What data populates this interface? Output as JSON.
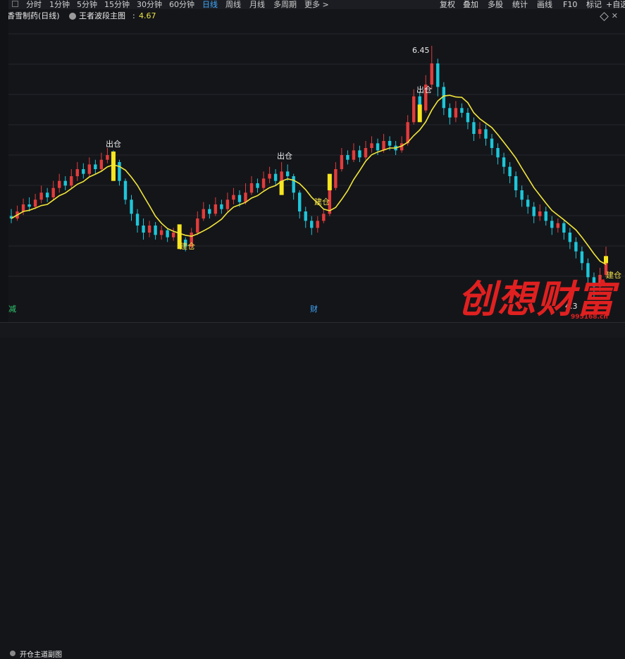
{
  "toolbar": {
    "periods": [
      "分时",
      "1分钟",
      "5分钟",
      "15分钟",
      "30分钟",
      "60分钟",
      "日线",
      "周线",
      "月线",
      "多周期",
      "更多 >"
    ],
    "active_period": "日线",
    "right_tools": [
      "复权",
      "叠加",
      "多股",
      "统计",
      "画线",
      "F10",
      "标记",
      "+自选"
    ]
  },
  "info": {
    "stock_name": "香雪制药(日线)",
    "indicator_name": "王者波段主图",
    "colon": ":",
    "indicator_value": "4.67"
  },
  "signals": {
    "sell_label": "出仓",
    "buy_label": "建仓"
  },
  "peak_price": "6.45",
  "bottom_price": "4.3",
  "bottom_tags": {
    "left": "减",
    "right": "财"
  },
  "sub_indicator": "开仓主道副图",
  "watermark": {
    "text": "创想财富",
    "url": "995168.cn"
  },
  "colors": {
    "up": "#e23c3c",
    "down": "#1ec6d9",
    "ma": "#f2e63a",
    "signal": "#f7e51f"
  },
  "chart_data": {
    "type": "candlestick",
    "note_series": "daily prices",
    "candles": [
      [
        5.0,
        4.98,
        5.06,
        4.94
      ],
      [
        4.98,
        5.04,
        5.09,
        4.96
      ],
      [
        5.04,
        5.1,
        5.15,
        5.01
      ],
      [
        5.1,
        5.08,
        5.16,
        5.04
      ],
      [
        5.08,
        5.14,
        5.19,
        5.06
      ],
      [
        5.14,
        5.2,
        5.26,
        5.11
      ],
      [
        5.2,
        5.16,
        5.24,
        5.12
      ],
      [
        5.16,
        5.24,
        5.3,
        5.14
      ],
      [
        5.24,
        5.3,
        5.36,
        5.2
      ],
      [
        5.3,
        5.26,
        5.34,
        5.22
      ],
      [
        5.26,
        5.34,
        5.4,
        5.24
      ],
      [
        5.34,
        5.4,
        5.46,
        5.3
      ],
      [
        5.4,
        5.36,
        5.45,
        5.32
      ],
      [
        5.36,
        5.44,
        5.5,
        5.33
      ],
      [
        5.44,
        5.4,
        5.48,
        5.36
      ],
      [
        5.4,
        5.48,
        5.54,
        5.38
      ],
      [
        5.48,
        5.52,
        5.58,
        5.45
      ],
      [
        5.52,
        5.46,
        5.56,
        5.42
      ],
      [
        5.46,
        5.3,
        5.48,
        5.26
      ],
      [
        5.3,
        5.14,
        5.32,
        5.1
      ],
      [
        5.14,
        5.02,
        5.18,
        4.96
      ],
      [
        5.02,
        4.92,
        5.06,
        4.86
      ],
      [
        4.92,
        4.86,
        4.98,
        4.8
      ],
      [
        4.86,
        4.92,
        4.96,
        4.82
      ],
      [
        4.92,
        4.84,
        4.95,
        4.8
      ],
      [
        4.84,
        4.88,
        4.92,
        4.8
      ],
      [
        4.88,
        4.82,
        4.9,
        4.78
      ],
      [
        4.82,
        4.86,
        4.9,
        4.79
      ],
      [
        4.86,
        4.8,
        4.88,
        4.76
      ],
      [
        4.8,
        4.74,
        4.82,
        4.7
      ],
      [
        4.74,
        4.86,
        4.9,
        4.72
      ],
      [
        4.86,
        4.98,
        5.04,
        4.84
      ],
      [
        4.98,
        5.06,
        5.12,
        4.96
      ],
      [
        5.06,
        5.02,
        5.1,
        4.98
      ],
      [
        5.02,
        5.1,
        5.16,
        5.0
      ],
      [
        5.1,
        5.06,
        5.14,
        5.02
      ],
      [
        5.06,
        5.14,
        5.2,
        5.04
      ],
      [
        5.14,
        5.18,
        5.24,
        5.1
      ],
      [
        5.18,
        5.12,
        5.22,
        5.08
      ],
      [
        5.12,
        5.2,
        5.28,
        5.1
      ],
      [
        5.2,
        5.28,
        5.34,
        5.18
      ],
      [
        5.28,
        5.24,
        5.32,
        5.2
      ],
      [
        5.24,
        5.32,
        5.38,
        5.22
      ],
      [
        5.32,
        5.36,
        5.42,
        5.28
      ],
      [
        5.36,
        5.3,
        5.4,
        5.26
      ],
      [
        5.3,
        5.38,
        5.46,
        5.28
      ],
      [
        5.38,
        5.34,
        5.44,
        5.3
      ],
      [
        5.34,
        5.2,
        5.36,
        5.14
      ],
      [
        5.2,
        5.04,
        5.22,
        4.98
      ],
      [
        5.04,
        4.96,
        5.08,
        4.9
      ],
      [
        4.96,
        4.9,
        5.0,
        4.84
      ],
      [
        4.9,
        4.96,
        5.0,
        4.86
      ],
      [
        4.96,
        5.02,
        5.06,
        4.94
      ],
      [
        5.02,
        5.24,
        5.28,
        5.0
      ],
      [
        5.24,
        5.4,
        5.46,
        5.22
      ],
      [
        5.4,
        5.52,
        5.58,
        5.38
      ],
      [
        5.52,
        5.48,
        5.56,
        5.44
      ],
      [
        5.48,
        5.56,
        5.62,
        5.46
      ],
      [
        5.56,
        5.5,
        5.6,
        5.46
      ],
      [
        5.5,
        5.58,
        5.64,
        5.48
      ],
      [
        5.58,
        5.62,
        5.68,
        5.54
      ],
      [
        5.62,
        5.56,
        5.66,
        5.52
      ],
      [
        5.56,
        5.64,
        5.7,
        5.54
      ],
      [
        5.64,
        5.6,
        5.68,
        5.56
      ],
      [
        5.6,
        5.56,
        5.64,
        5.52
      ],
      [
        5.56,
        5.62,
        5.68,
        5.54
      ],
      [
        5.62,
        5.8,
        5.86,
        5.6
      ],
      [
        5.8,
        6.02,
        6.08,
        5.78
      ],
      [
        6.02,
        5.9,
        6.06,
        5.84
      ],
      [
        5.9,
        6.12,
        6.2,
        5.88
      ],
      [
        6.12,
        6.3,
        6.45,
        6.08
      ],
      [
        6.3,
        6.1,
        6.34,
        6.02
      ],
      [
        6.1,
        5.92,
        6.14,
        5.86
      ],
      [
        5.92,
        5.84,
        5.96,
        5.78
      ],
      [
        5.84,
        5.92,
        5.98,
        5.8
      ],
      [
        5.92,
        5.88,
        5.96,
        5.84
      ],
      [
        5.88,
        5.8,
        5.92,
        5.74
      ],
      [
        5.8,
        5.7,
        5.84,
        5.64
      ],
      [
        5.7,
        5.74,
        5.8,
        5.66
      ],
      [
        5.74,
        5.66,
        5.78,
        5.6
      ],
      [
        5.66,
        5.58,
        5.7,
        5.52
      ],
      [
        5.58,
        5.5,
        5.62,
        5.44
      ],
      [
        5.5,
        5.42,
        5.54,
        5.36
      ],
      [
        5.42,
        5.34,
        5.46,
        5.28
      ],
      [
        5.34,
        5.22,
        5.38,
        5.16
      ],
      [
        5.22,
        5.14,
        5.26,
        5.08
      ],
      [
        5.14,
        5.08,
        5.18,
        5.02
      ],
      [
        5.08,
        5.0,
        5.12,
        4.94
      ],
      [
        5.0,
        5.04,
        5.1,
        4.96
      ],
      [
        5.04,
        4.96,
        5.08,
        4.92
      ],
      [
        4.96,
        4.9,
        5.0,
        4.84
      ],
      [
        4.9,
        4.94,
        4.98,
        4.86
      ],
      [
        4.94,
        4.86,
        4.96,
        4.8
      ],
      [
        4.86,
        4.78,
        4.9,
        4.72
      ],
      [
        4.78,
        4.7,
        4.82,
        4.64
      ],
      [
        4.7,
        4.6,
        4.74,
        4.54
      ],
      [
        4.6,
        4.48,
        4.64,
        4.42
      ],
      [
        4.48,
        4.4,
        4.52,
        4.3
      ],
      [
        4.4,
        4.5,
        4.56,
        4.36
      ],
      [
        4.5,
        4.66,
        4.74,
        4.48
      ]
    ],
    "ylim": [
      4.2,
      6.6
    ]
  }
}
